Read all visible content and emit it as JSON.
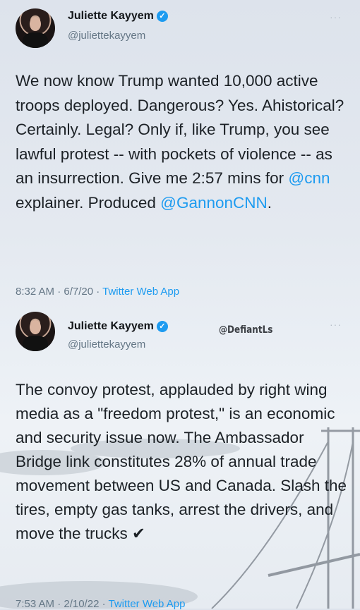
{
  "tweets": [
    {
      "name": "Juliette Kayyem",
      "handle": "@juliettekayyem",
      "more": "···",
      "text_parts": [
        "We now know Trump wanted 10,000 active troops deployed. Dangerous? Yes. Ahistorical? Certainly. Legal? Only if, like Trump, you see lawful protest -- with pockets of violence -- as an insurrection. Give me 2:57 mins for ",
        "@cnn",
        " explainer. Produced ",
        "@GannonCNN",
        "."
      ],
      "time": "8:32 AM · 6/7/20 · ",
      "app": "Twitter Web App"
    },
    {
      "name": "Juliette Kayyem",
      "handle": "@juliettekayyem",
      "more": "···",
      "watermark": "@DefiantLs",
      "text": "The convoy protest, applauded by right wing media as a \"freedom protest,\" is an economic and security issue now. The Ambassador Bridge link constitutes 28% of annual trade movement between US and Canada. Slash the tires, empty gas tanks, arrest the drivers, and move the trucks ✔",
      "time": "7:53 AM · 2/10/22 · ",
      "app": "Twitter Web App"
    }
  ],
  "colors": {
    "link": "#1d9bf0",
    "muted": "#657786",
    "text": "#1c2126"
  }
}
